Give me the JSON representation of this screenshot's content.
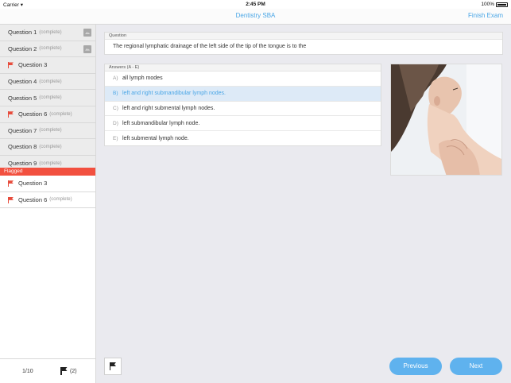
{
  "status_bar": {
    "carrier": "Carrier",
    "time": "2:45 PM",
    "battery": "100%"
  },
  "nav": {
    "title": "Dentistry SBA",
    "finish_label": "Finish Exam"
  },
  "questions": [
    {
      "label": "Question 1",
      "status": "(complete)",
      "flagged": false,
      "has_image": true
    },
    {
      "label": "Question 2",
      "status": "(complete)",
      "flagged": false,
      "has_image": true
    },
    {
      "label": "Question 3",
      "status": "",
      "flagged": true,
      "has_image": false
    },
    {
      "label": "Question 4",
      "status": "(complete)",
      "flagged": false,
      "has_image": false
    },
    {
      "label": "Question 5",
      "status": "(complete)",
      "flagged": false,
      "has_image": false
    },
    {
      "label": "Question 6",
      "status": "(complete)",
      "flagged": true,
      "has_image": false
    },
    {
      "label": "Question 7",
      "status": "(complete)",
      "flagged": false,
      "has_image": false
    },
    {
      "label": "Question 8",
      "status": "(complete)",
      "flagged": false,
      "has_image": false
    },
    {
      "label": "Question 9",
      "status": "(complete)",
      "flagged": false,
      "has_image": false
    }
  ],
  "flagged": {
    "header": "Flagged",
    "items": [
      {
        "label": "Question 3",
        "status": ""
      },
      {
        "label": "Question 6",
        "status": "(complete)"
      }
    ]
  },
  "sidebar_footer": {
    "progress": "1/10",
    "flag_count": "(2)"
  },
  "question": {
    "header": "Question",
    "text": "The regional lymphatic drainage of the left side of the tip of the tongue is to the"
  },
  "answers": {
    "header": "Answers (A - E)",
    "items": [
      {
        "letter": "A)",
        "text": "all lymph modes",
        "selected": false
      },
      {
        "letter": "B)",
        "text": "left and right submandibular lymph nodes.",
        "selected": true
      },
      {
        "letter": "C)",
        "text": "left and right submental lymph nodes.",
        "selected": false
      },
      {
        "letter": "D)",
        "text": "left submandibular lymph node.",
        "selected": false
      },
      {
        "letter": "E)",
        "text": "left submental lymph node.",
        "selected": false
      }
    ]
  },
  "buttons": {
    "previous": "Previous",
    "next": "Next"
  },
  "icons": {
    "question_flag": "flag-icon",
    "image_thumbnail": "image-icon",
    "wifi": "wifi-icon",
    "battery": "battery-icon"
  },
  "colors": {
    "accent": "#4aa6e6",
    "flag_red": "#f2503f",
    "button": "#5fb2ee",
    "selected_bg": "#ddeaf7"
  }
}
